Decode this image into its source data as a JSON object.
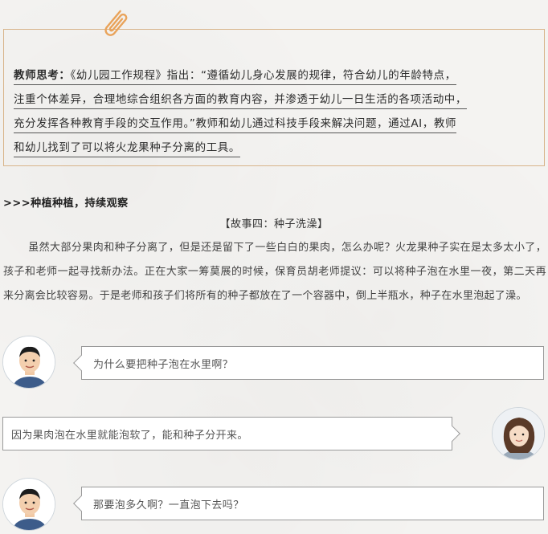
{
  "reflection": {
    "lead": "教师思考：",
    "lines": [
      "《幼儿园工作规程》指出：“遵循幼儿身心发展的规律，符合幼儿的年龄特点，",
      "注重个体差异，合理地综合组织各方面的教育内容，并渗透于幼儿一日生活的各项活动中，",
      "充分发挥各种教育手段的交互作用。”教师和幼儿通过科技手段来解决问题，通过AI，教师",
      "和幼儿找到了可以将火龙果种子分离的工具。"
    ]
  },
  "section": {
    "heading": ">>>种植种植，持续观察"
  },
  "story": {
    "title": "【故事四：种子洗澡】",
    "body": "虽然大部分果肉和种子分离了，但是还是留下了一些白白的果肉，怎么办呢？火龙果种子实在是太多太小了，孩子和老师一起寻找新办法。正在大家一筹莫展的时候，保育员胡老师提议：可以将种子泡在水里一夜，第二天再来分离会比较容易。于是老师和孩子们将所有的种子都放在了一个容器中，倒上半瓶水，种子在水里泡起了澡。"
  },
  "chat": [
    {
      "speaker": "child",
      "text": "为什么要把种子泡在水里啊？"
    },
    {
      "speaker": "teacher",
      "text": "因为果肉泡在水里就能泡软了，能和种子分开来。"
    },
    {
      "speaker": "child",
      "text": "那要泡多久啊？一直泡下去吗？"
    }
  ],
  "colors": {
    "box_border": "#d8b48a",
    "clip": "#e9a35a",
    "bubble_border": "#9a9a9a"
  },
  "icons": {
    "clip": "paperclip-icon",
    "child_avatar": "child-avatar",
    "teacher_avatar": "teacher-avatar"
  }
}
